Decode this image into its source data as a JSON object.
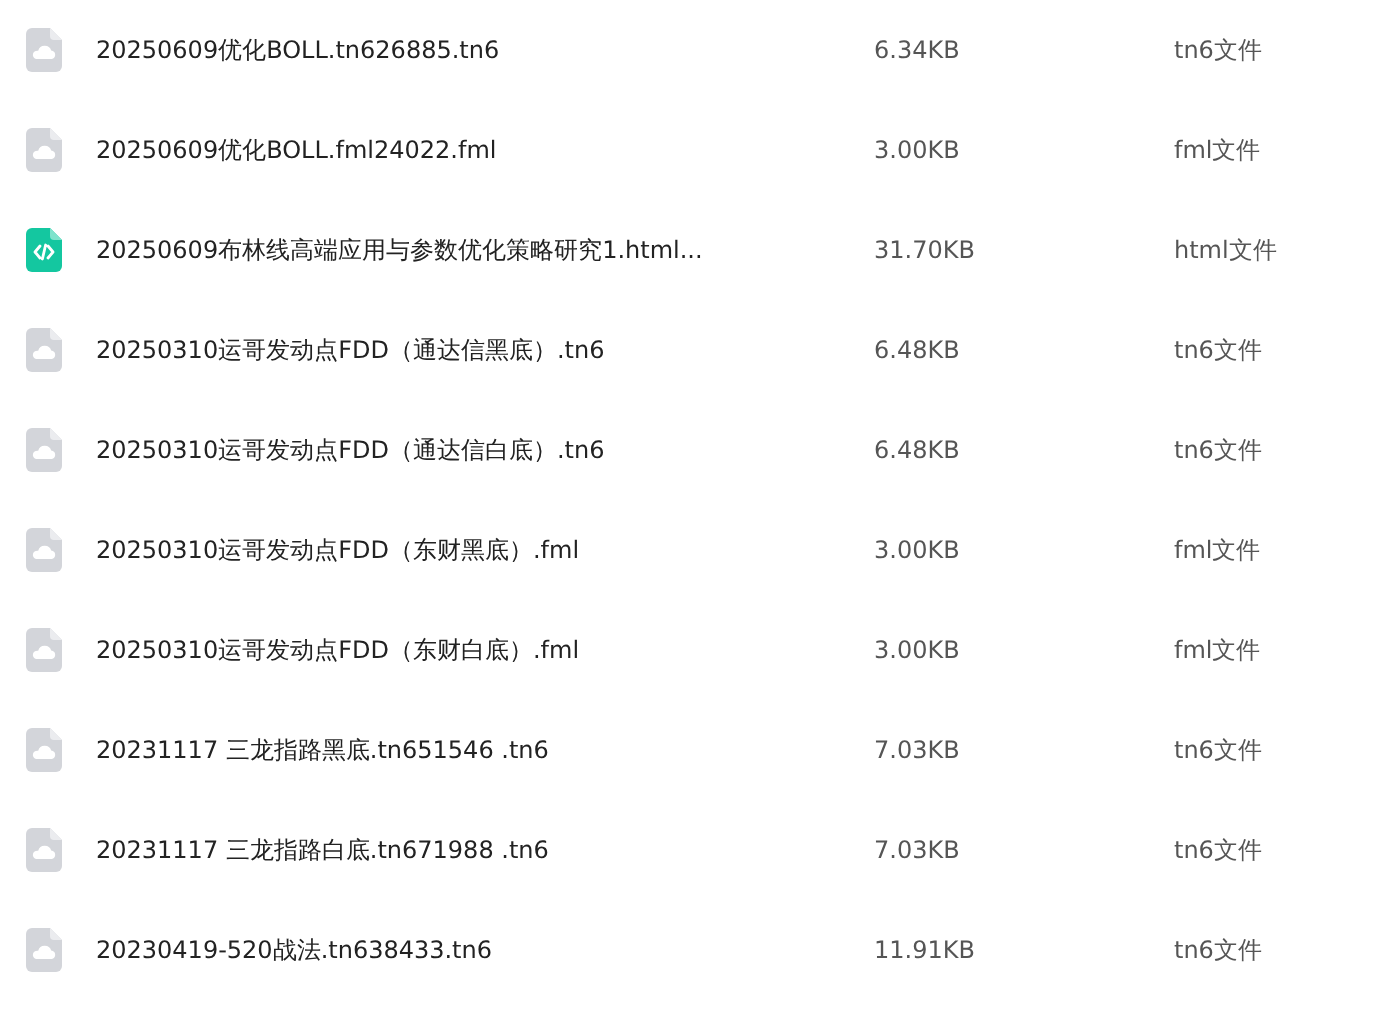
{
  "files": [
    {
      "kind": "generic",
      "name": "20250609优化BOLL.tn626885.tn6",
      "size": "6.34KB",
      "type": "tn6文件"
    },
    {
      "kind": "generic",
      "name": "20250609优化BOLL.fml24022.fml",
      "size": "3.00KB",
      "type": "fml文件"
    },
    {
      "kind": "code",
      "name": "20250609布林线高端应用与参数优化策略研究1.html...",
      "size": "31.70KB",
      "type": "html文件"
    },
    {
      "kind": "generic",
      "name": "20250310运哥发动点FDD（通达信黑底）.tn6",
      "size": "6.48KB",
      "type": "tn6文件"
    },
    {
      "kind": "generic",
      "name": "20250310运哥发动点FDD（通达信白底）.tn6",
      "size": "6.48KB",
      "type": "tn6文件"
    },
    {
      "kind": "generic",
      "name": "20250310运哥发动点FDD（东财黑底）.fml",
      "size": "3.00KB",
      "type": "fml文件"
    },
    {
      "kind": "generic",
      "name": "20250310运哥发动点FDD（东财白底）.fml",
      "size": "3.00KB",
      "type": "fml文件"
    },
    {
      "kind": "generic",
      "name": "20231117 三龙指路黑底.tn651546 .tn6",
      "size": "7.03KB",
      "type": "tn6文件"
    },
    {
      "kind": "generic",
      "name": "20231117 三龙指路白底.tn671988 .tn6",
      "size": "7.03KB",
      "type": "tn6文件"
    },
    {
      "kind": "generic",
      "name": "20230419-520战法.tn638433.tn6",
      "size": "11.91KB",
      "type": "tn6文件"
    }
  ]
}
